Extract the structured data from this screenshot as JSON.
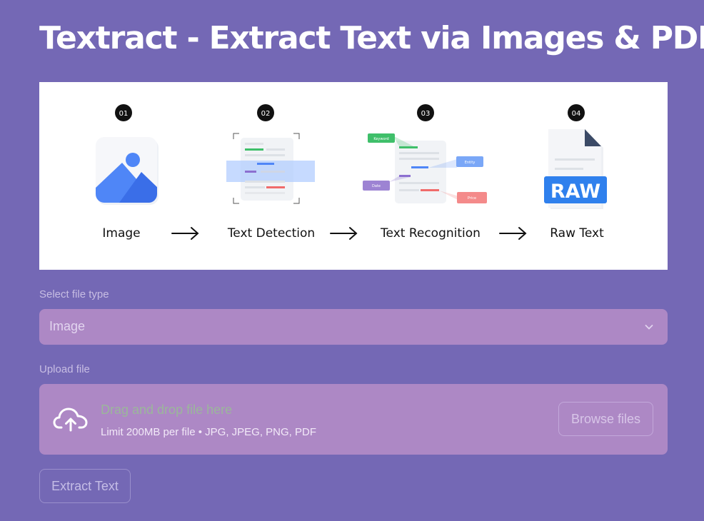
{
  "page": {
    "title": "Textract - Extract Text via Images & PDFs"
  },
  "banner": {
    "steps": [
      {
        "number": "01",
        "label": "Image",
        "icon": "image-icon"
      },
      {
        "number": "02",
        "label": "Text Detection",
        "icon": "text-detection-icon"
      },
      {
        "number": "03",
        "label": "Text Recognition",
        "icon": "text-recognition-icon"
      },
      {
        "number": "04",
        "label": "Raw Text",
        "icon": "raw-document-icon"
      }
    ],
    "tags": {
      "keyword": "Keyword",
      "entity": "Entity",
      "date": "Date",
      "price": "Price"
    },
    "raw_badge": "RAW"
  },
  "file_type": {
    "label": "Select file type",
    "value": "Image",
    "icon": "chevron-down-icon"
  },
  "upload": {
    "label": "Upload file",
    "drop_text": "Drag and drop file here",
    "limit_text": "Limit 200MB per file • JPG, JPEG, PNG, PDF",
    "browse_label": "Browse files",
    "icon": "cloud-upload-icon"
  },
  "actions": {
    "extract_label": "Extract Text"
  },
  "colors": {
    "background": "#7468b5",
    "input_bg": "#ad88c5",
    "accent_blue": "#4f86f7"
  }
}
